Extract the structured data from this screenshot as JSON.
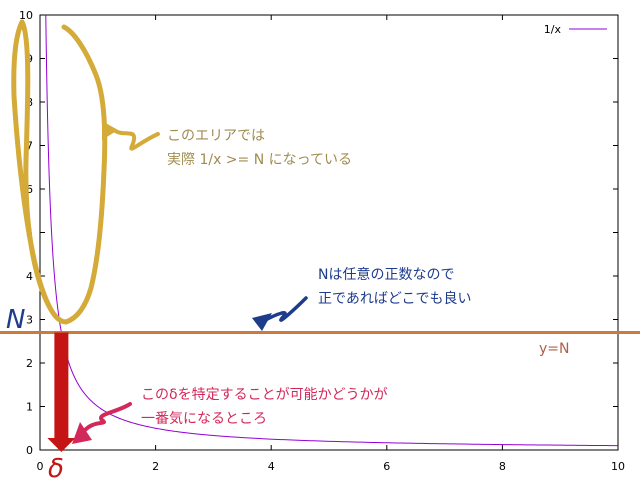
{
  "chart_data": {
    "type": "line",
    "xlim": [
      0,
      10
    ],
    "ylim": [
      0,
      10
    ],
    "xticks": [
      "0",
      "2",
      "4",
      "6",
      "8",
      "10"
    ],
    "yticks": [
      "0",
      "1",
      "2",
      "3",
      "4",
      "5",
      "6",
      "7",
      "8",
      "9",
      "10"
    ],
    "legend": {
      "placement": "top-right"
    },
    "series": [
      {
        "name": "1/x",
        "function": "1/x",
        "x_start": 0.1,
        "x_end": 10,
        "color": "#9400d3"
      }
    ],
    "threshold": {
      "y": 2.7,
      "label": "y=N",
      "color": "#cc7a3d"
    },
    "delta_x": 0.37,
    "grid": false
  },
  "annotations": {
    "n_symbol": "N",
    "delta_symbol": "δ",
    "area_note": [
      "このエリアでは",
      "実際 1/x >= N になっている"
    ],
    "n_note": [
      "Nは任意の正数なので",
      "正であればどこでも良い"
    ],
    "delta_note": [
      "このδを特定することが可能かどうかが",
      "一番気になるところ"
    ],
    "colors": {
      "area": "#a08c50",
      "area_marker": "#d4aa38",
      "n": "#1e3c8c",
      "delta": "#d2285a",
      "arrow": "#c41414",
      "threshold": "#cc7a3d"
    }
  }
}
